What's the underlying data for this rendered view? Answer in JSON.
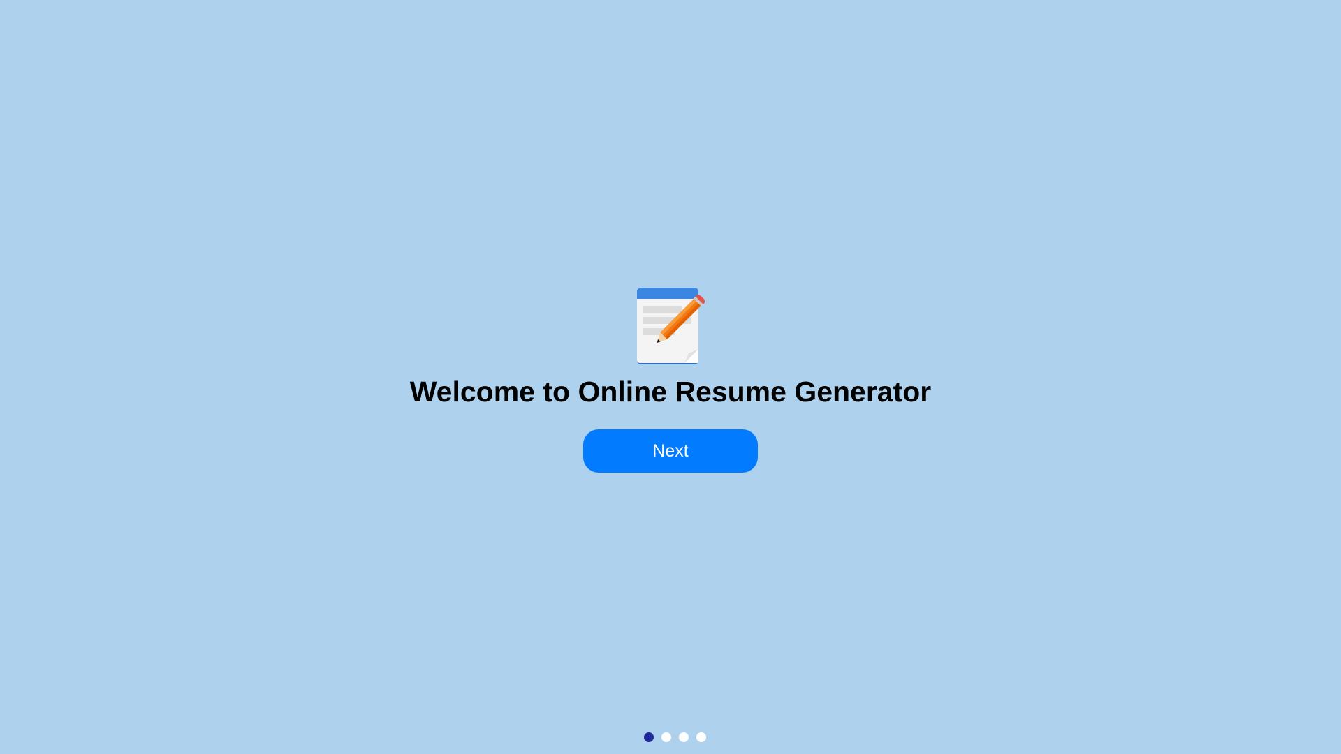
{
  "welcome": {
    "title": "Welcome to Online Resume Generator",
    "next_label": "Next"
  },
  "logo_icon": "resume-edit-icon",
  "pagination": {
    "total_steps": 4,
    "current_step": 1
  },
  "colors": {
    "background": "#aed2ee",
    "button": "#037bff",
    "active_dot": "#1f2b9a",
    "inactive_dot": "#ffffff"
  }
}
